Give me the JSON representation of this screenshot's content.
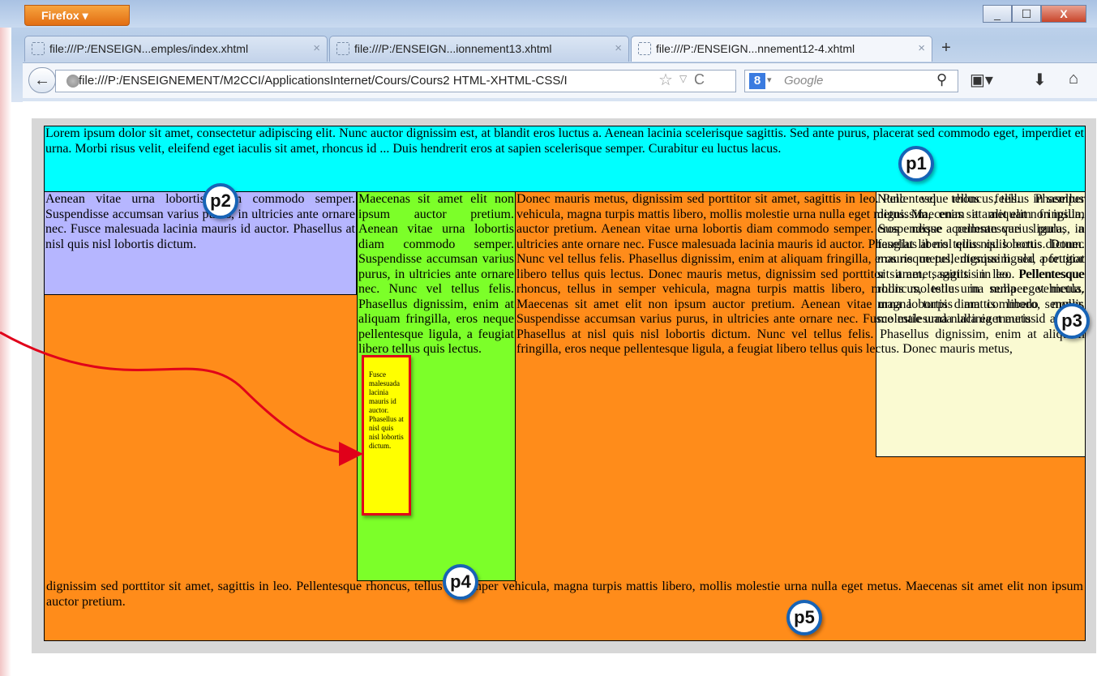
{
  "browser": {
    "menu_label": "Firefox",
    "window_controls": {
      "minimize": "_",
      "maximize": "☐",
      "close": "X"
    },
    "tabs": [
      {
        "title": "file:///P:/ENSEIGN...emples/index.xhtml",
        "close": "×"
      },
      {
        "title": "file:///P:/ENSEIGN...ionnement13.xhtml",
        "close": "×"
      },
      {
        "title": "file:///P:/ENSEIGN...nnement12-4.xhtml",
        "close": "×",
        "active": true
      }
    ],
    "new_tab": "+",
    "url": "file:///P:/ENSEIGNEMENT/M2CCI/ApplicationsInternet/Cours/Cours2 HTML-XHTML-CSS/I",
    "search_placeholder": "Google",
    "search_engine_icon": "8",
    "icons": [
      "back-icon",
      "globe-icon",
      "star-icon",
      "reload-icon",
      "google-icon",
      "search-icon",
      "bookmarks-icon",
      "download-icon",
      "home-icon"
    ]
  },
  "page": {
    "p1_text": "Lorem ipsum dolor sit amet, consectetur adipiscing elit. Nunc auctor dignissim est, at blandit eros luctus a. Aenean lacinia scelerisque sagittis. Sed ante purus, placerat sed commodo eget, imperdiet et urna. Morbi risus velit, eleifend eget iaculis sit amet, rhoncus id ... Duis hendrerit eros at sapien scelerisque semper. Curabitur eu luctus lacus.",
    "p2_text": "Aenean vitae urna lobortis diam commodo semper. Suspendisse accumsan varius purus, in ultricies ante ornare nec. Fusce malesuada lacinia mauris id auctor. Phasellus at nisl quis nisl lobortis dictum.",
    "p4_text": "Maecenas sit amet elit non ipsum auctor pretium. Aenean vitae urna lobortis diam commodo semper. Suspendisse accumsan varius purus, in ultricies ante ornare nec. Nunc vel tellus felis. Phasellus dignissim, enim at aliquam fringilla, eros neque pellentesque ligula, a feugiat libero tellus quis lectus.",
    "p3_text": "Nunc vel tellus felis. Phasellus dignissim, enim at aliquam fringilla, eros neque pellentesque ligula, a feugiat libero tellus quis lectus. Donec mauris metus, dignissim sed porttitor sit amet, sagittis in leo. Pellentesque rhoncus, tellus in semper vehicula, magna turpis mattis libero, mollis molestie urna nulla eget metus.",
    "p5_text_main": "Donec mauris metus, dignissim sed porttitor sit amet, sagittis in leo. Pellentesque rhoncus, tellus in semper vehicula, magna turpis mattis libero, mollis molestie urna nulla eget metus. Maecenas sit amet elit non ipsum auctor pretium. Aenean vitae urna lobortis diam commodo semper. Suspendisse accumsan varius purus, in ultricies ante ornare nec. Fusce malesuada lacinia mauris id auctor. Phasellus at nisl quis nisl lobortis dictum. Nunc vel tellus felis. Phasellus dignissim, enim at aliquam fringilla, eros neque pellentesque ligula, a feugiat libero tellus quis lectus. Donec mauris metus, dignissim sed porttitor sit amet, sagittis in leo. Pellentesque rhoncus, tellus in semper vehicula, magna turpis mattis libero, mollis molestie urna nulla eget metus. Maecenas sit amet elit non ipsum auctor pretium. Aenean vitae urna lobortis diam commodo semper. Suspendisse accumsan varius purus, in ultricies ante ornare nec. Fusce malesuada lacinia mauris id auctor. Phasellus at nisl quis nisl lobortis dictum. Nunc vel tellus felis. Phasellus dignissim, enim at aliquam fringilla, eros neque pellentesque ligula, a feugiat libero tellus quis lectus. Donec mauris metus,",
    "p5_text_tail": "dignissim sed porttitor sit amet, sagittis in leo. Pellentesque rhoncus, tellus in semper vehicula, magna turpis mattis libero, mollis molestie urna nulla eget metus. Maecenas sit amet elit non ipsum auctor pretium.",
    "p6_text": "Fusce malesuada lacinia mauris id auctor. Phasellus at nisl quis nisl lobortis dictum."
  },
  "callouts": {
    "p1": "p1",
    "p2": "p2",
    "p3": "p3",
    "p4": "p4",
    "p5": "p5"
  },
  "colors": {
    "p1": "#00ffff",
    "p2": "#b6b6ff",
    "p3": "#fafad2",
    "p4": "#7cff29",
    "p5": "#ff8c1a",
    "p6": "#ffff00",
    "p6_border": "#e0001a",
    "callout_ring": "#1763b6",
    "arrow": "#e0001a"
  }
}
